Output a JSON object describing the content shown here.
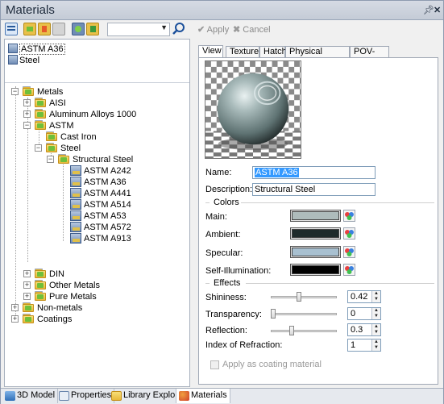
{
  "window": {
    "title": "Materials",
    "pin_icon": "pin-icon",
    "close_icon": "close-icon"
  },
  "toolbar": {
    "apply_label": "Apply",
    "cancel_label": "Cancel",
    "combo_value": ""
  },
  "material_list": [
    {
      "label": "ASTM A36",
      "selected": true
    },
    {
      "label": "Steel",
      "selected": false
    }
  ],
  "tree": {
    "metals": "Metals",
    "aisi": "AISI",
    "aluminum": "Aluminum Alloys 1000",
    "astm": "ASTM",
    "cast_iron": "Cast Iron",
    "steel": "Steel",
    "structural_steel": "Structural Steel",
    "leaves": [
      "ASTM A242",
      "ASTM A36",
      "ASTM A441",
      "ASTM A514",
      "ASTM A53",
      "ASTM A572",
      "ASTM A913"
    ],
    "din": "DIN",
    "other_metals": "Other Metals",
    "pure_metals": "Pure Metals",
    "non_metals": "Non-metals",
    "coatings": "Coatings"
  },
  "tabs": [
    "View",
    "Texture",
    "Hatch",
    "Physical Properties",
    "POV-Ray"
  ],
  "view": {
    "name_label": "Name:",
    "name_value": "ASTM A36",
    "description_label": "Description:",
    "description_value": "Structural Steel",
    "colors_title": "Colors",
    "colors": [
      {
        "label": "Main:",
        "hex": "#aebcbc"
      },
      {
        "label": "Ambient:",
        "hex": "#1f2b2b"
      },
      {
        "label": "Specular:",
        "hex": "#a8c0d0"
      },
      {
        "label": "Self-Illumination:",
        "hex": "#000000"
      }
    ],
    "effects_title": "Effects",
    "shininess_label": "Shininess:",
    "shininess_value": "0.42",
    "transparency_label": "Transparency:",
    "transparency_value": "0",
    "reflection_label": "Reflection:",
    "reflection_value": "0.3",
    "ior_label": "Index of Refraction:",
    "ior_value": "1",
    "coating_label": "Apply as coating material"
  },
  "bottom_tabs": [
    "3D Model",
    "Properties",
    "Library Explorer",
    "Materials"
  ]
}
